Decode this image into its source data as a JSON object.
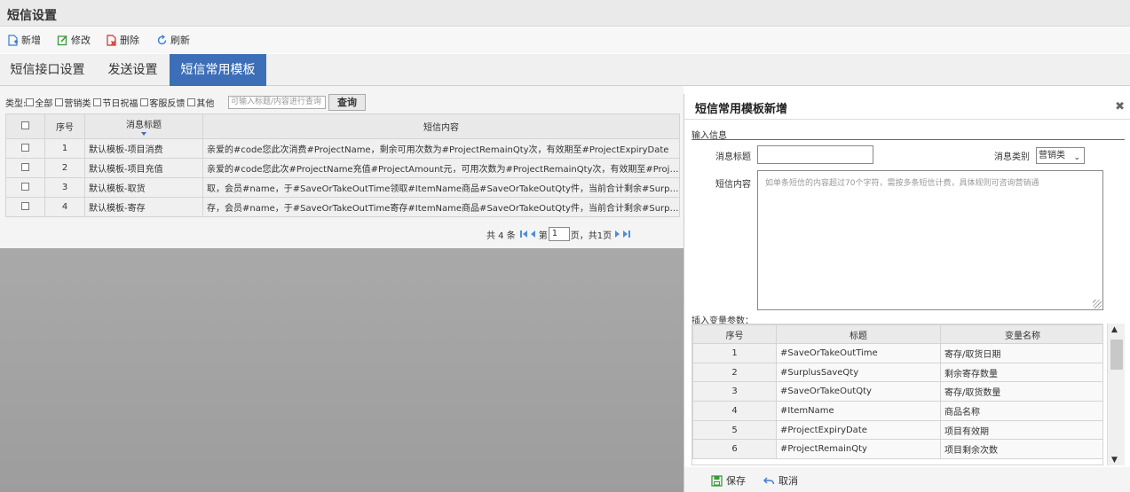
{
  "page_title": "短信设置",
  "toolbar": {
    "add_label": "新增",
    "edit_label": "修改",
    "delete_label": "删除",
    "refresh_label": "刷新"
  },
  "tabs": [
    {
      "label": "短信接口设置",
      "active": false
    },
    {
      "label": "发送设置",
      "active": false
    },
    {
      "label": "短信常用模板",
      "active": true
    }
  ],
  "filter": {
    "type_label": "类型:",
    "options": [
      "全部",
      "营销类",
      "节日祝福",
      "客服反馈",
      "其他"
    ],
    "search_placeholder": "可输入标题/内容进行查询",
    "query_label": "查询"
  },
  "main_table": {
    "headers": [
      "序号",
      "消息标题",
      "短信内容"
    ],
    "rows": [
      {
        "index": "1",
        "title": "默认模板-项目消费",
        "content": "亲爱的#code您此次消费#ProjectName，剩余可用次数为#ProjectRemainQty次，有效期至#ProjectExpiryDate"
      },
      {
        "index": "2",
        "title": "默认模板-项目充值",
        "content": "亲爱的#code您此次#ProjectName充值#ProjectAmount元，可用次数为#ProjectRemainQty次，有效期至#ProjectExpi..."
      },
      {
        "index": "3",
        "title": "默认模板-取货",
        "content": "取，会员#name，于#SaveOrTakeOutTime领取#ItemName商品#SaveOrTakeOutQty件，当前合计剩余#SurplusSave..."
      },
      {
        "index": "4",
        "title": "默认模板-寄存",
        "content": "存，会员#name，于#SaveOrTakeOutTime寄存#ItemName商品#SaveOrTakeOutQty件，当前合计剩余#SurplusSave..."
      }
    ]
  },
  "pager": {
    "total_text": "共 4 条",
    "page_prefix": "第",
    "page_value": "1",
    "page_suffix": "页，共1页"
  },
  "dialog": {
    "title": "短信常用模板新增",
    "section_label": "输入信息",
    "title_field_label": "消息标题",
    "category_label": "消息类别",
    "category_value": "营销类",
    "content_label": "短信内容",
    "content_placeholder": "如单条短信的内容超过70个字符，需按多条短信计费，具体规则可咨询营销通",
    "var_label": "插入变量参数：",
    "var_headers": [
      "序号",
      "标题",
      "变量名称"
    ],
    "var_rows": [
      {
        "index": "1",
        "title": "#SaveOrTakeOutTime",
        "name": "寄存/取货日期"
      },
      {
        "index": "2",
        "title": "#SurplusSaveQty",
        "name": "剩余寄存数量"
      },
      {
        "index": "3",
        "title": "#SaveOrTakeOutQty",
        "name": "寄存/取货数量"
      },
      {
        "index": "4",
        "title": "#ItemName",
        "name": "商品名称"
      },
      {
        "index": "5",
        "title": "#ProjectExpiryDate",
        "name": "项目有效期"
      },
      {
        "index": "6",
        "title": "#ProjectRemainQty",
        "name": "项目剩余次数"
      }
    ],
    "save_label": "保存",
    "cancel_label": "取消"
  },
  "colors": {
    "accent": "#3d6fb8",
    "add_icon": "#3a7bd5",
    "edit_icon": "#3a9a3a",
    "delete_icon": "#d03030",
    "save_icon": "#3a9a3a"
  }
}
